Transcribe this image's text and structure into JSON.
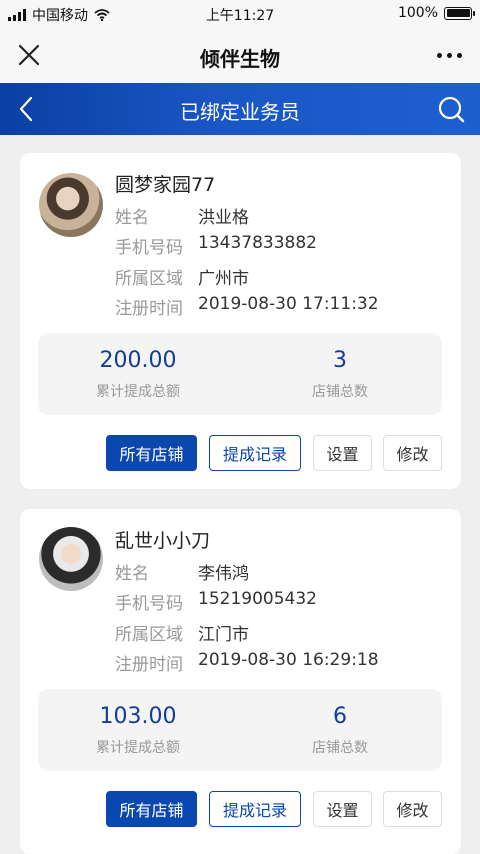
{
  "status_bar": {
    "carrier": "中国移动",
    "time": "上午11:27",
    "battery_text": "100%",
    "battery_level": 1.0
  },
  "app_header": {
    "title": "倾伴生物",
    "close_icon": "close-icon",
    "more_icon": "more-dots-icon"
  },
  "nav": {
    "title": "已绑定业务员",
    "back_icon": "back-chevron-icon",
    "search_icon": "search-icon",
    "gradient_start": "#0b3fa3",
    "gradient_end": "#1e5fd0"
  },
  "labels": {
    "name": "姓名",
    "phone": "手机号码",
    "region": "所属区域",
    "register_time": "注册时间",
    "total_withdraw": "累计提成总额",
    "total_shops": "店铺总数"
  },
  "buttons": {
    "all_shops": "所有店铺",
    "withdraw_records": "提成记录",
    "settings": "设置",
    "edit": "修改"
  },
  "colors": {
    "primary": "#0b47b0",
    "stat_value": "#123c97"
  },
  "salesmen": [
    {
      "shop_name": "圆梦家园77",
      "name": "洪业格",
      "phone": "13437833882",
      "region": "广州市",
      "register_time": "2019-08-30 17:11:32",
      "total_withdraw": "200.00",
      "total_shops": "3"
    },
    {
      "shop_name": "乱世小小刀",
      "name": "李伟鸿",
      "phone": "15219005432",
      "region": "江门市",
      "register_time": "2019-08-30 16:29:18",
      "total_withdraw": "103.00",
      "total_shops": "6"
    }
  ]
}
